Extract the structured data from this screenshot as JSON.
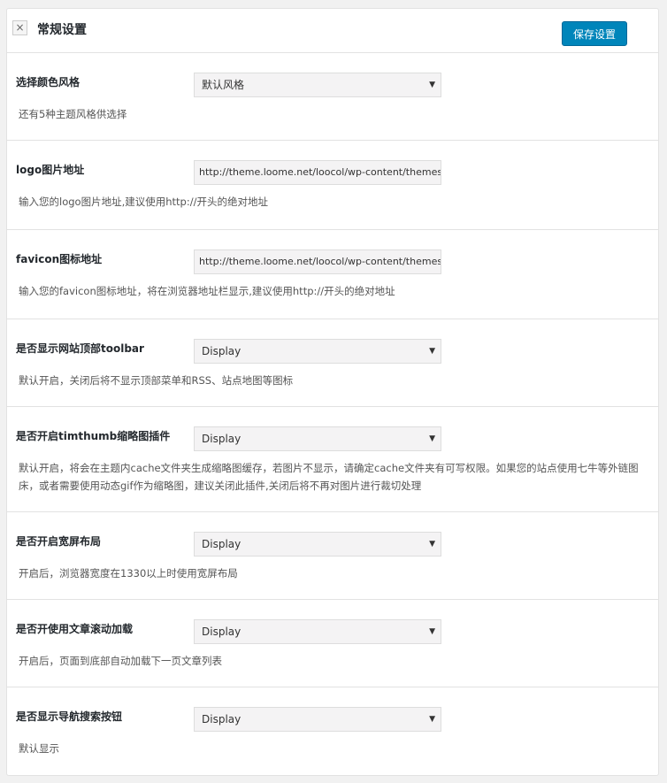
{
  "header": {
    "title": "常规设置",
    "save_label": "保存设置",
    "close_icon": "×"
  },
  "sections": [
    {
      "label": "选择颜色风格",
      "type": "select",
      "value": "默认风格",
      "desc": "还有5种主题风格供选择"
    },
    {
      "label": "logo图片地址",
      "type": "input",
      "value": "http://theme.loome.net/loocol/wp-content/themes",
      "desc": "输入您的logo图片地址,建议使用http://开头的绝对地址"
    },
    {
      "label": "favicon图标地址",
      "type": "input",
      "value": "http://theme.loome.net/loocol/wp-content/themes",
      "desc": "输入您的favicon图标地址，将在浏览器地址栏显示,建议使用http://开头的绝对地址"
    },
    {
      "label": "是否显示网站顶部toolbar",
      "type": "select",
      "value": "Display",
      "desc": "默认开启，关闭后将不显示顶部菜单和RSS、站点地图等图标"
    },
    {
      "label": "是否开启timthumb缩略图插件",
      "type": "select",
      "value": "Display",
      "desc": "默认开启，将会在主题内cache文件夹生成缩略图缓存，若图片不显示，请确定cache文件夹有可写权限。如果您的站点使用七牛等外链图床，或者需要使用动态gif作为缩略图，建议关闭此插件,关闭后将不再对图片进行裁切处理"
    },
    {
      "label": "是否开启宽屏布局",
      "type": "select",
      "value": "Display",
      "desc": "开启后，浏览器宽度在1330以上时使用宽屏布局"
    },
    {
      "label": "是否开使用文章滚动加载",
      "type": "select",
      "value": "Display",
      "desc": "开启后，页面到底部自动加载下一页文章列表"
    },
    {
      "label": "是否显示导航搜索按钮",
      "type": "select",
      "value": "Display",
      "desc": "默认显示"
    }
  ]
}
